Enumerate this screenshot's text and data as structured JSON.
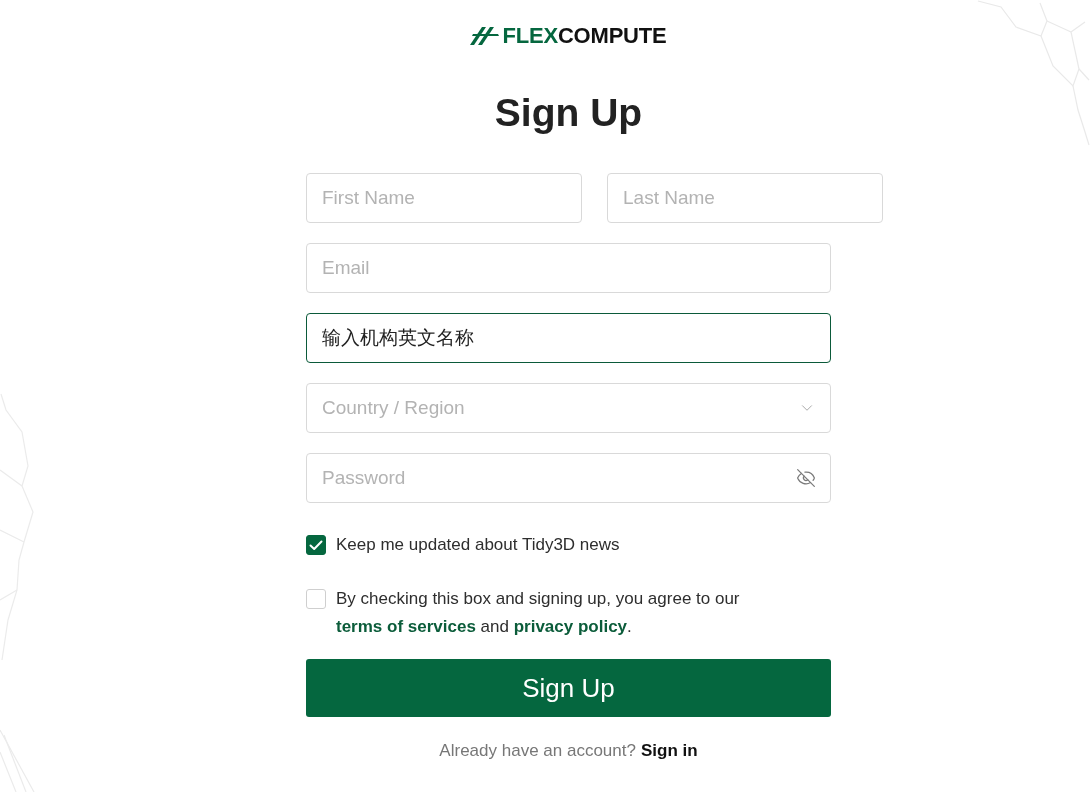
{
  "logo": {
    "lead": "FLEX",
    "rest": "COMPUTE"
  },
  "title": "Sign Up",
  "name_fields": [
    {
      "placeholder": "First Name",
      "focused": false
    },
    {
      "placeholder": "Last Name",
      "focused": false
    }
  ],
  "fields": [
    {
      "kind": "text",
      "placeholder": "Email",
      "focused": false
    },
    {
      "kind": "text",
      "value": "输入机构英文名称",
      "focused": true
    },
    {
      "kind": "select",
      "placeholder": "Country / Region",
      "focused": false
    },
    {
      "kind": "password",
      "placeholder": "Password",
      "focused": false
    }
  ],
  "checkboxes": [
    {
      "checked": true,
      "parts": [
        {
          "text": "Keep me updated about Tidy3D news",
          "link": false
        }
      ]
    },
    {
      "checked": false,
      "parts": [
        {
          "text": "By checking this box and signing up, you agree to our ",
          "link": false
        },
        {
          "text": "terms of services",
          "link": true
        },
        {
          "text": " and ",
          "link": false
        },
        {
          "text": "privacy policy",
          "link": true
        },
        {
          "text": ".",
          "link": false
        }
      ]
    }
  ],
  "submit": "Sign Up",
  "footer": {
    "prompt": "Already have an account?",
    "link": "Sign in"
  }
}
